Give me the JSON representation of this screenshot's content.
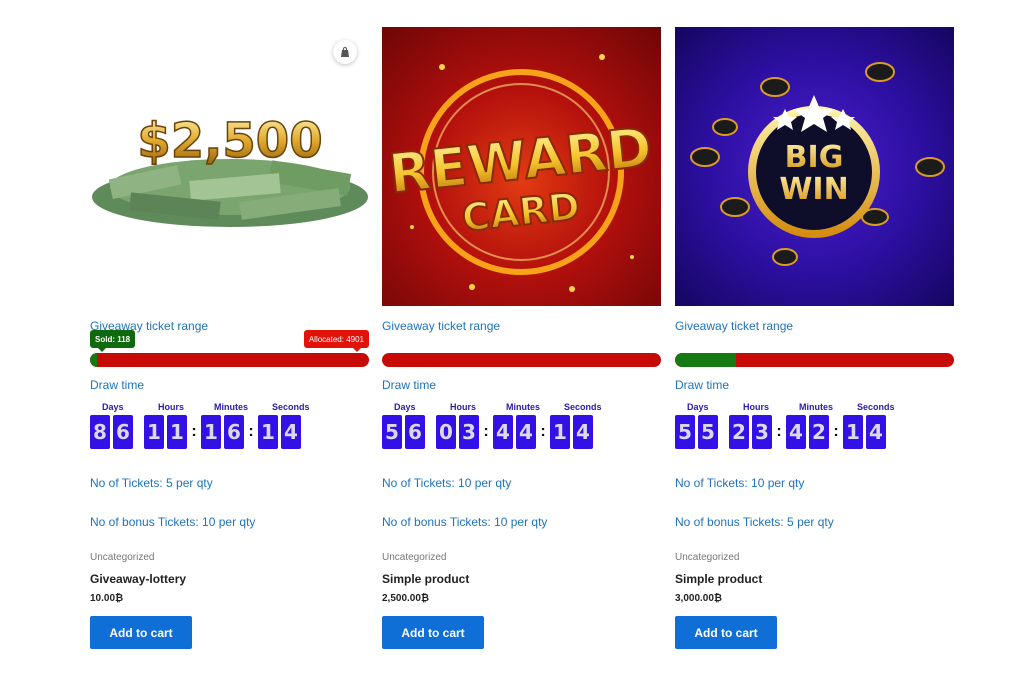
{
  "products": [
    {
      "image_text": "$2,500",
      "range_label": "Giveaway ticket range",
      "sold_label": "Sold: 118",
      "allocated_label": "Allocated: 4901",
      "sold_fraction": 0.024,
      "draw_label": "Draw time",
      "countdown_labels": {
        "days": "Days",
        "hours": "Hours",
        "minutes": "Minutes",
        "seconds": "Seconds"
      },
      "countdown": {
        "days": "86",
        "hours": "11",
        "minutes": "16",
        "seconds": "14"
      },
      "tickets": "No of Tickets: 5 per qty",
      "bonus": "No of bonus Tickets: 10 per qty",
      "category": "Uncategorized",
      "title": "Giveaway-lottery",
      "price": "10.00₿",
      "button": "Add to cart"
    },
    {
      "image_text": {
        "line1": "REWARD",
        "line2": "CARD"
      },
      "range_label": "Giveaway ticket range",
      "sold_fraction": 0.0,
      "draw_label": "Draw time",
      "countdown_labels": {
        "days": "Days",
        "hours": "Hours",
        "minutes": "Minutes",
        "seconds": "Seconds"
      },
      "countdown": {
        "days": "56",
        "hours": "03",
        "minutes": "44",
        "seconds": "14"
      },
      "tickets": "No of Tickets: 10 per qty",
      "bonus": "No of bonus Tickets: 10 per qty",
      "category": "Uncategorized",
      "title": "Simple product",
      "price": "2,500.00₿",
      "button": "Add to cart"
    },
    {
      "image_text": {
        "line1": "BIG",
        "line2": "WIN"
      },
      "range_label": "Giveaway ticket range",
      "sold_fraction": 0.22,
      "draw_label": "Draw time",
      "countdown_labels": {
        "days": "Days",
        "hours": "Hours",
        "minutes": "Minutes",
        "seconds": "Seconds"
      },
      "countdown": {
        "days": "55",
        "hours": "23",
        "minutes": "42",
        "seconds": "14"
      },
      "tickets": "No of Tickets: 10 per qty",
      "bonus": "No of bonus Tickets: 5 per qty",
      "category": "Uncategorized",
      "title": "Simple product",
      "price": "3,000.00₿",
      "button": "Add to cart"
    }
  ],
  "icons": {
    "cart": "shopping-bag-icon"
  },
  "colors": {
    "link": "#1e73be",
    "button": "#0f6fd6",
    "sold": "#157a12",
    "remaining": "#c60b06",
    "digit_bg": "#3210e6"
  }
}
